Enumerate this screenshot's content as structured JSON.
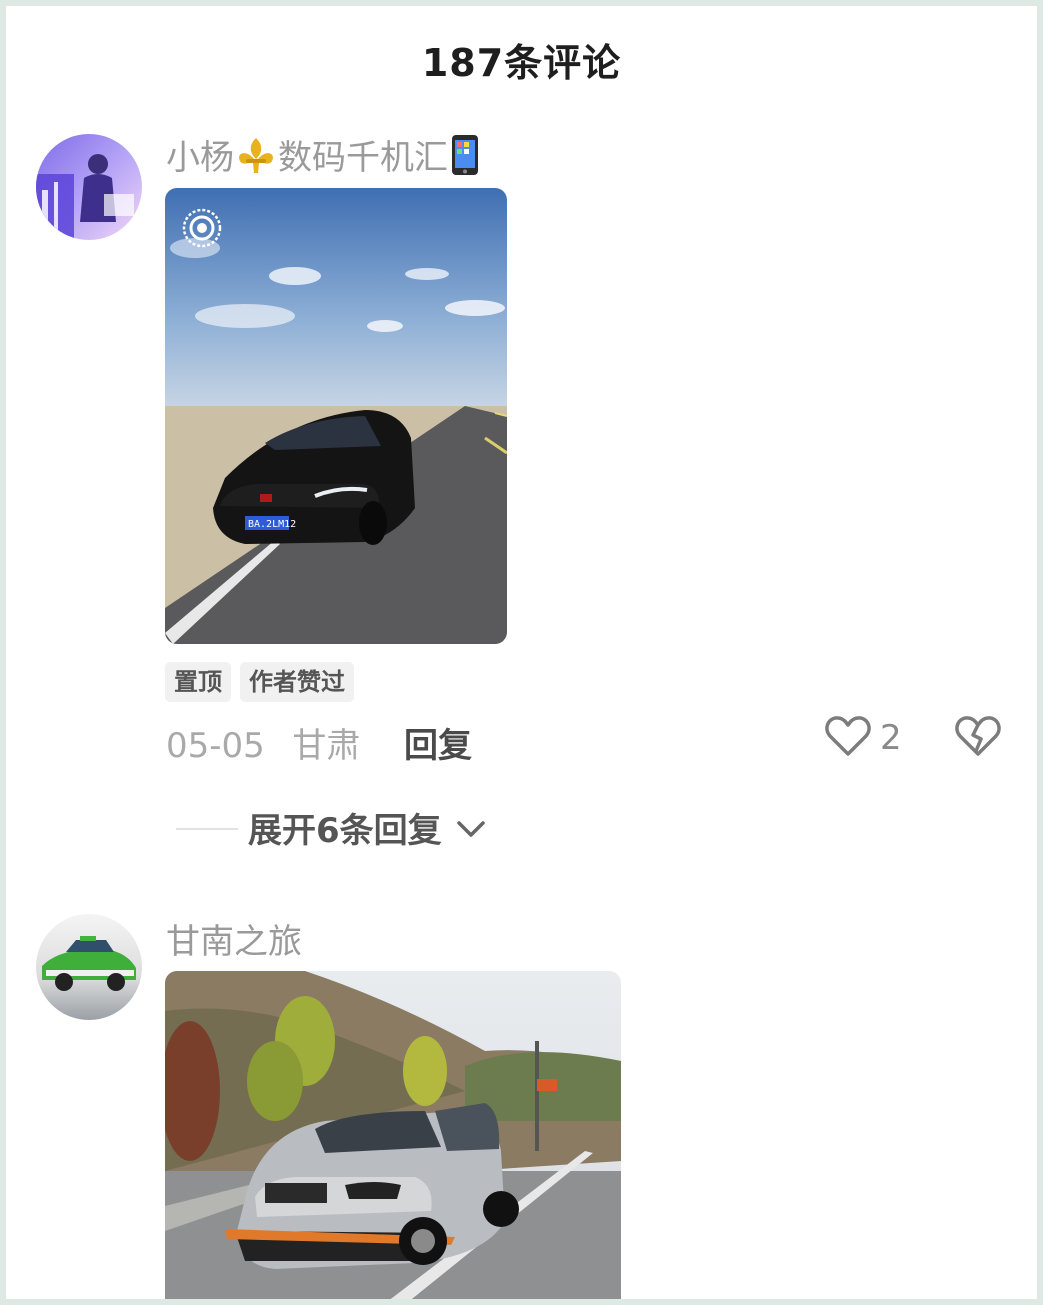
{
  "header": {
    "title": "187条评论"
  },
  "comments": [
    {
      "username": "小杨",
      "username_suffix": "数码千机汇",
      "username_icons": [
        "fleur-de-lis-icon",
        "phone-icon"
      ],
      "tags": [
        "置顶",
        "作者赞过"
      ],
      "date": "05-05",
      "location": "甘肃",
      "reply_label": "回复",
      "like_count": "2",
      "expand_label": "展开6条回复"
    },
    {
      "username": "甘南之旅"
    }
  ],
  "colors": {
    "accent_text": "#1e1e1e",
    "muted_text": "#9a9a9a",
    "tag_bg": "#f1f1f1",
    "frame_border": "#dfe9e4"
  }
}
